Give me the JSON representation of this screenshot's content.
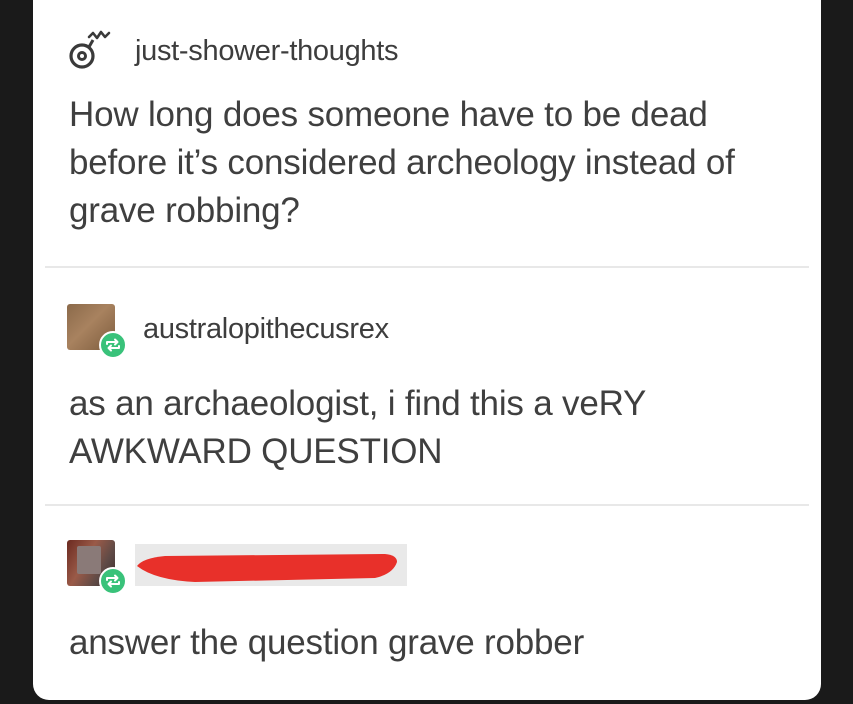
{
  "posts": [
    {
      "username": "just-shower-thoughts",
      "avatar_icon": "shower-head-icon",
      "text": "How long does someone have to be dead\nbefore it’s considered archeology instead of\ngrave robbing?"
    },
    {
      "username": "australopithecusrex",
      "avatar_icon": "avatar-image",
      "badge_icon": "reblog-icon",
      "text": "as an archaeologist, i find this a veRY\nAWKWARD QUESTION"
    },
    {
      "username": "",
      "username_redacted": true,
      "avatar_icon": "avatar-image",
      "badge_icon": "reblog-icon",
      "text": "answer the question grave robber"
    }
  ],
  "colors": {
    "background": "#1a1a1a",
    "card": "#ffffff",
    "text": "#3f3f3f",
    "reblog_badge": "#39c27a",
    "redaction_mark": "#e8302a"
  }
}
